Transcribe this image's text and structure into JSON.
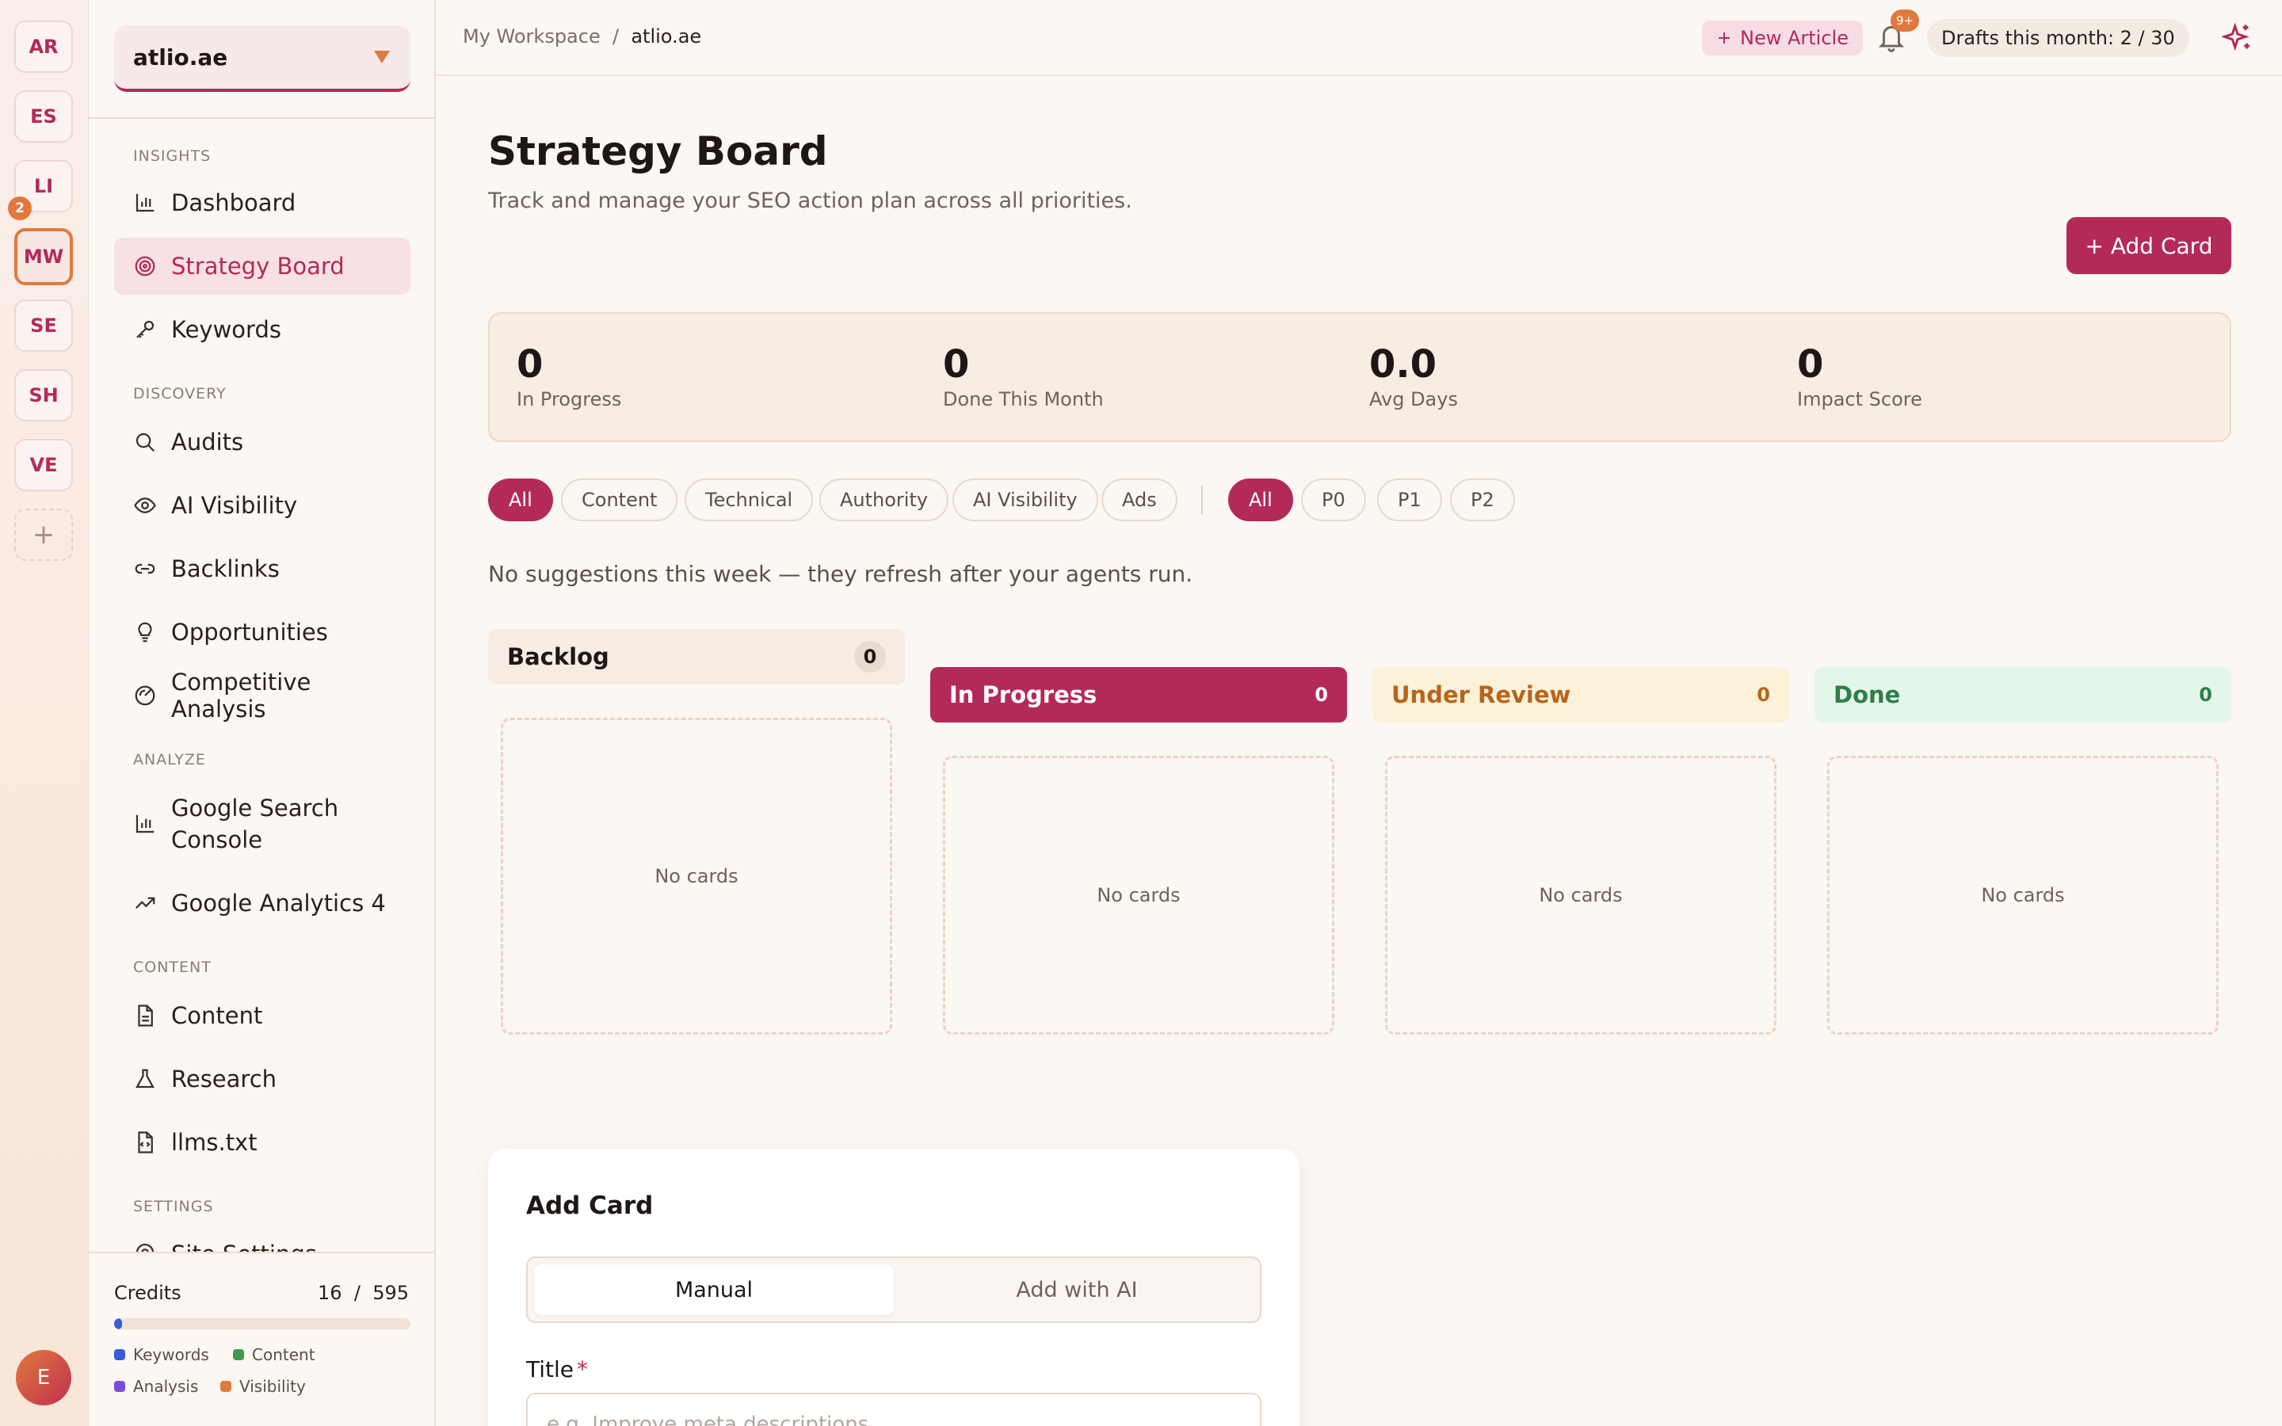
{
  "rail": {
    "workspaces": [
      "AR",
      "ES",
      "LI",
      "MW",
      "SE",
      "SH",
      "VE"
    ],
    "active": "MW",
    "badge": "2",
    "add_label": "+",
    "user_initial": "E"
  },
  "sidebar": {
    "site_name": "atlio.ae",
    "sections": {
      "insights": "INSIGHTS",
      "discovery": "DISCOVERY",
      "analyze": "ANALYZE",
      "content": "CONTENT",
      "settings": "SETTINGS"
    },
    "items": {
      "dashboard": "Dashboard",
      "strategy_board": "Strategy Board",
      "keywords": "Keywords",
      "audits": "Audits",
      "ai_visibility": "AI Visibility",
      "backlinks": "Backlinks",
      "opportunities": "Opportunities",
      "competitive_analysis": "Competitive Analysis",
      "gsc_line1": "Google Search",
      "gsc_line2": "Console",
      "ga4": "Google Analytics 4",
      "content": "Content",
      "research": "Research",
      "llms": "llms.txt",
      "site_settings": "Site Settings"
    },
    "credits": {
      "label": "Credits",
      "used": "16",
      "sep": "/",
      "total": "595",
      "fraction_used": 0.027,
      "legend": [
        "Keywords",
        "Content",
        "Analysis",
        "Visibility"
      ],
      "legend_colors": [
        "#3b5bdb",
        "#3d9a4f",
        "#7c4ddb",
        "#e0793e"
      ]
    }
  },
  "topbar": {
    "crumb_root": "My Workspace",
    "crumb_sep": "/",
    "crumb_current": "atlio.ae",
    "new_article": "New Article",
    "notifications_badge": "9+",
    "drafts": "Drafts this month: 2 / 30"
  },
  "page": {
    "title": "Strategy Board",
    "subtitle": "Track and manage your SEO action plan across all priorities.",
    "add_card_button": "+ Add Card",
    "no_suggestions": "No suggestions this week — they refresh after your agents run."
  },
  "stats": [
    {
      "value": "0",
      "label": "In Progress"
    },
    {
      "value": "0",
      "label": "Done This Month"
    },
    {
      "value": "0.0",
      "label": "Avg Days"
    },
    {
      "value": "0",
      "label": "Impact Score"
    }
  ],
  "filters": {
    "category": [
      "All",
      "Content",
      "Technical",
      "Authority",
      "AI Visibility",
      "Ads"
    ],
    "priority": [
      "All",
      "P0",
      "P1",
      "P2"
    ],
    "selected_category": "All",
    "selected_priority": "All"
  },
  "columns": [
    {
      "name": "Backlog",
      "count": "0",
      "empty": "No cards"
    },
    {
      "name": "In Progress",
      "count": "0",
      "empty": "No cards"
    },
    {
      "name": "Under Review",
      "count": "0",
      "empty": "No cards"
    },
    {
      "name": "Done",
      "count": "0",
      "empty": "No cards"
    }
  ],
  "add_form": {
    "title": "Add Card",
    "tab_manual": "Manual",
    "tab_ai": "Add with AI",
    "field_title_label": "Title",
    "required_mark": "*",
    "field_title_placeholder": "e.g. Improve meta descriptions"
  },
  "colors": {
    "accent": "#b32a59",
    "orange": "#e0793e",
    "review_bg": "#fcf1d9",
    "review_text": "#b7651c",
    "done_bg": "#e4f6ea",
    "done_text": "#2f7d47"
  }
}
